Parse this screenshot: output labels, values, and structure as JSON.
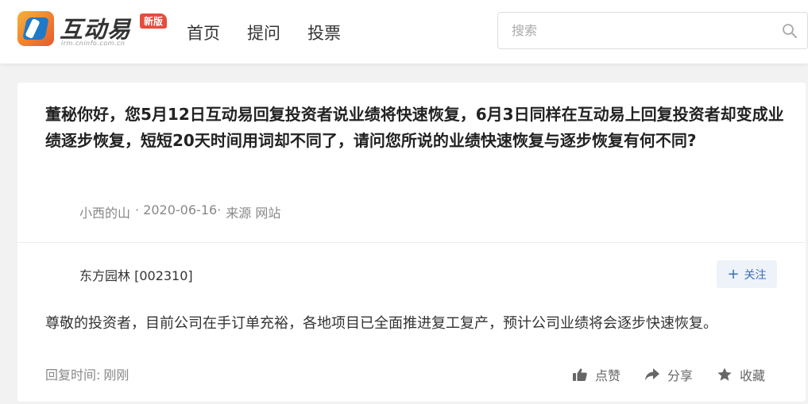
{
  "header": {
    "logo": {
      "name": "互动易",
      "sub": "irm.cninfo.com.cn",
      "badge": "新版"
    },
    "nav": [
      {
        "label": "首页"
      },
      {
        "label": "提问"
      },
      {
        "label": "投票"
      }
    ],
    "search": {
      "placeholder": "搜索",
      "value": "",
      "icon": "search-icon"
    }
  },
  "question": {
    "text": "董秘你好，您5月12日互动易回复投资者说业绩将快速恢复，6月3日同样在互动易上回复投资者却变成业绩逐步恢复，短短20天时间用词却不同了，请问您所说的业绩快速恢复与逐步恢复有何不同?",
    "author": "小西的山",
    "date": "· 2020-06-16·",
    "source": "来源 网站"
  },
  "answer": {
    "company": "东方园林 [002310]",
    "follow_label": "关注",
    "text": "尊敬的投资者，目前公司在手订单充裕，各地项目已全面推进复工复产，预计公司业绩将会逐步快速恢复。",
    "reply_time_label": "回复时间:",
    "reply_time_value": "刚刚",
    "actions": {
      "like": {
        "label": "点赞",
        "icon": "thumbs-up-icon"
      },
      "share": {
        "label": "分享",
        "icon": "share-arrow-icon"
      },
      "favorite": {
        "label": "收藏",
        "icon": "star-icon"
      }
    }
  },
  "colors": {
    "accent": "#3a6fb0",
    "badge": "#e64b3c",
    "logo_blue": "#1e79c8",
    "logo_orange": "#e8592a"
  }
}
